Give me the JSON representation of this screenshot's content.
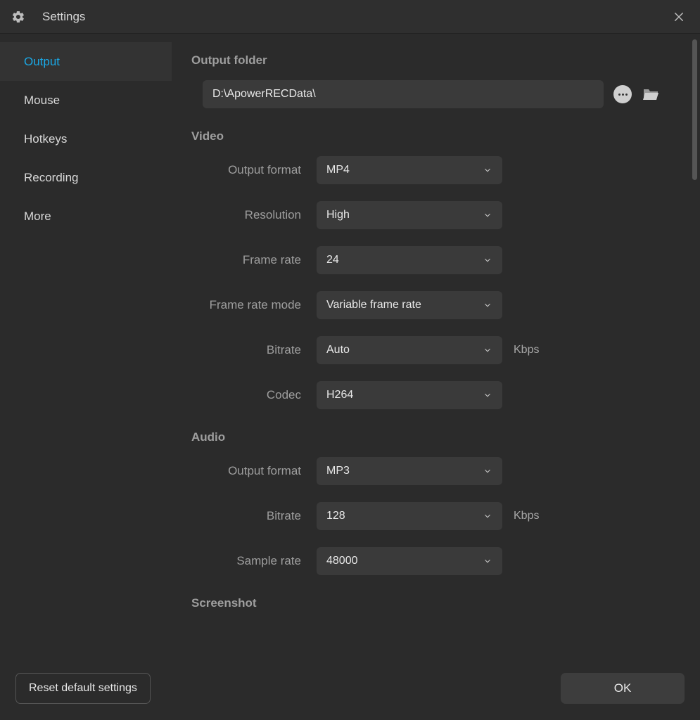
{
  "header": {
    "title": "Settings"
  },
  "sidebar": {
    "items": [
      {
        "label": "Output",
        "active": true
      },
      {
        "label": "Mouse",
        "active": false
      },
      {
        "label": "Hotkeys",
        "active": false
      },
      {
        "label": "Recording",
        "active": false
      },
      {
        "label": "More",
        "active": false
      }
    ]
  },
  "sections": {
    "output_folder": {
      "title": "Output folder",
      "path": "D:\\ApowerRECData\\"
    },
    "video": {
      "title": "Video",
      "rows": {
        "output_format": {
          "label": "Output format",
          "value": "MP4"
        },
        "resolution": {
          "label": "Resolution",
          "value": "High"
        },
        "frame_rate": {
          "label": "Frame rate",
          "value": "24"
        },
        "frame_rate_mode": {
          "label": "Frame rate mode",
          "value": "Variable frame rate"
        },
        "bitrate": {
          "label": "Bitrate",
          "value": "Auto",
          "unit": "Kbps"
        },
        "codec": {
          "label": "Codec",
          "value": "H264"
        }
      }
    },
    "audio": {
      "title": "Audio",
      "rows": {
        "output_format": {
          "label": "Output format",
          "value": "MP3"
        },
        "bitrate": {
          "label": "Bitrate",
          "value": "128",
          "unit": "Kbps"
        },
        "sample_rate": {
          "label": "Sample rate",
          "value": "48000"
        }
      }
    },
    "screenshot": {
      "title": "Screenshot"
    }
  },
  "footer": {
    "reset": "Reset default settings",
    "ok": "OK"
  }
}
